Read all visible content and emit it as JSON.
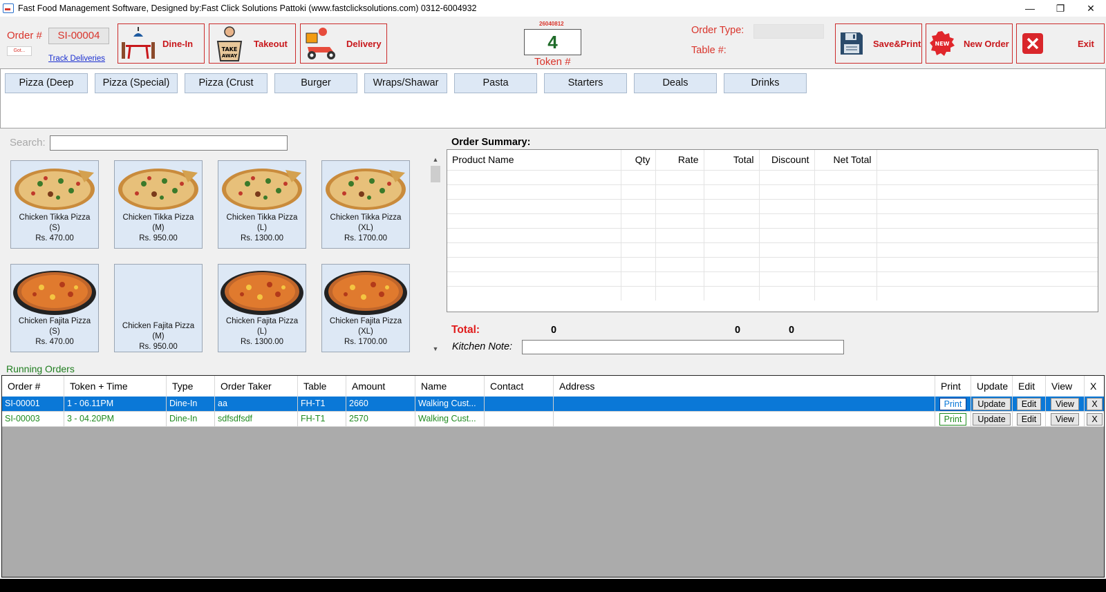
{
  "window": {
    "title": "Fast Food Management Software, Designed by:Fast Click Solutions Pattoki (www.fastclicksolutions.com) 0312-6004932",
    "controls": [
      "—",
      "❐",
      "✕"
    ]
  },
  "header": {
    "order_label": "Order #",
    "order_no": "SI-00004",
    "got_label": "Got...",
    "track_link": "Track Deliveries",
    "dine_in": "Dine-In",
    "takeout": "Takeout",
    "delivery": "Delivery",
    "token_code": "26040812",
    "token_value": "4",
    "token_label": "Token #",
    "order_type_label": "Order Type:",
    "order_type_value": "",
    "table_label": "Table #:",
    "save_print": "Save&Print",
    "new_order": "New Order",
    "new_badge": "NEW",
    "exit": "Exit"
  },
  "categories": [
    "Pizza (Deep",
    "Pizza (Special)",
    "Pizza (Crust",
    "Burger",
    "Wraps/Shawar",
    "Pasta",
    "Starters",
    "Deals",
    "Drinks"
  ],
  "search": {
    "label": "Search:",
    "value": ""
  },
  "products": [
    {
      "name": "Chicken Tikka Pizza (S)",
      "price": "Rs. 470.00",
      "image": "tikka"
    },
    {
      "name": "Chicken Tikka Pizza (M)",
      "price": "Rs. 950.00",
      "image": "tikka"
    },
    {
      "name": "Chicken Tikka Pizza (L)",
      "price": "Rs. 1300.00",
      "image": "tikka"
    },
    {
      "name": "Chicken Tikka Pizza (XL)",
      "price": "Rs. 1700.00",
      "image": "tikka"
    },
    {
      "name": "Chicken Fajita Pizza (S)",
      "price": "Rs. 470.00",
      "image": "fajita"
    },
    {
      "name": "Chicken Fajita Pizza (M)",
      "price": "Rs. 950.00",
      "image": "none"
    },
    {
      "name": "Chicken Fajita Pizza (L)",
      "price": "Rs. 1300.00",
      "image": "fajita"
    },
    {
      "name": "Chicken Fajita Pizza (XL)",
      "price": "Rs. 1700.00",
      "image": "fajita"
    }
  ],
  "summary": {
    "title": "Order Summary:",
    "columns": [
      "Product Name",
      "Qty",
      "Rate",
      "Total",
      "Discount",
      "Net Total"
    ],
    "total_label": "Total:",
    "total_qty": "0",
    "total_amount": "0",
    "total_discount": "0",
    "kitchen_note_label": "Kitchen Note:",
    "kitchen_note": ""
  },
  "running": {
    "label": "Running Orders",
    "columns": [
      "Order #",
      "Token  + Time",
      "Type",
      "Order Taker",
      "Table",
      "Amount",
      "Name",
      "Contact",
      "Address",
      "Print",
      "Update",
      "Edit",
      "View",
      "X"
    ],
    "rows": [
      {
        "order": "SI-00001",
        "token_time": "1 - 06.11PM",
        "type": "Dine-In",
        "taker": "aa",
        "table": "FH-T1",
        "amount": "2660",
        "name": "Walking Cust...",
        "contact": "",
        "address": "",
        "print": "Print",
        "update": "Update",
        "edit": "Edit",
        "view": "View",
        "x": "X"
      },
      {
        "order": "SI-00003",
        "token_time": "3 - 04.20PM",
        "type": "Dine-In",
        "taker": "sdfsdfsdf",
        "table": "FH-T1",
        "amount": "2570",
        "name": "Walking Cust...",
        "contact": "",
        "address": "",
        "print": "Print",
        "update": "Update",
        "edit": "Edit",
        "view": "View",
        "x": "X"
      }
    ]
  },
  "colors": {
    "accent_red": "#c8171b",
    "selected_row": "#0a78d7",
    "running_green": "#1e8a1e",
    "tile_blue": "#dde8f5"
  }
}
